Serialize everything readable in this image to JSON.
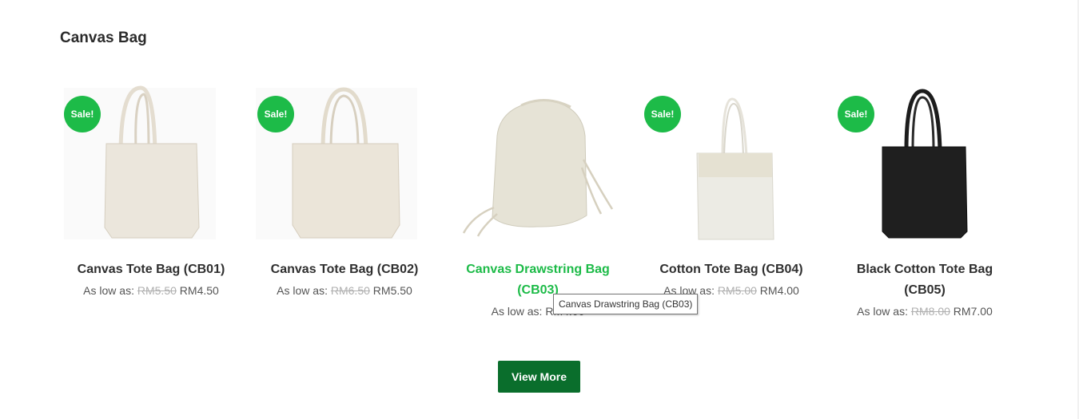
{
  "section": {
    "title": "Canvas Bag"
  },
  "price_prefix": "As low as: ",
  "products": [
    {
      "name": "Canvas Tote Bag (CB01)",
      "badge": "Sale!",
      "old_price": "RM5.50",
      "price": "RM4.50",
      "bag_color": "#ebe6dc"
    },
    {
      "name": "Canvas Tote Bag (CB02)",
      "badge": "Sale!",
      "old_price": "RM6.50",
      "price": "RM5.50",
      "bag_color": "#ebe5d9"
    },
    {
      "name": "Canvas Drawstring Bag (CB03)",
      "badge": "",
      "old_price": "",
      "price": "RM4.00",
      "bag_color": "#e6e3d6"
    },
    {
      "name": "Cotton Tote Bag (CB04)",
      "badge": "Sale!",
      "old_price": "RM5.00",
      "price": "RM4.00",
      "bag_color": "#ecebe4"
    },
    {
      "name": "Black Cotton Tote Bag (CB05)",
      "badge": "Sale!",
      "old_price": "RM8.00",
      "price": "RM7.00",
      "bag_color": "#1f1f1f"
    }
  ],
  "tooltip": {
    "text": "Canvas Drawstring Bag (CB03)"
  },
  "view_more": {
    "label": "View More"
  },
  "colors": {
    "sale_badge": "#1dbb48",
    "button": "#0a6e2c",
    "hover_link": "#1dbb48"
  }
}
